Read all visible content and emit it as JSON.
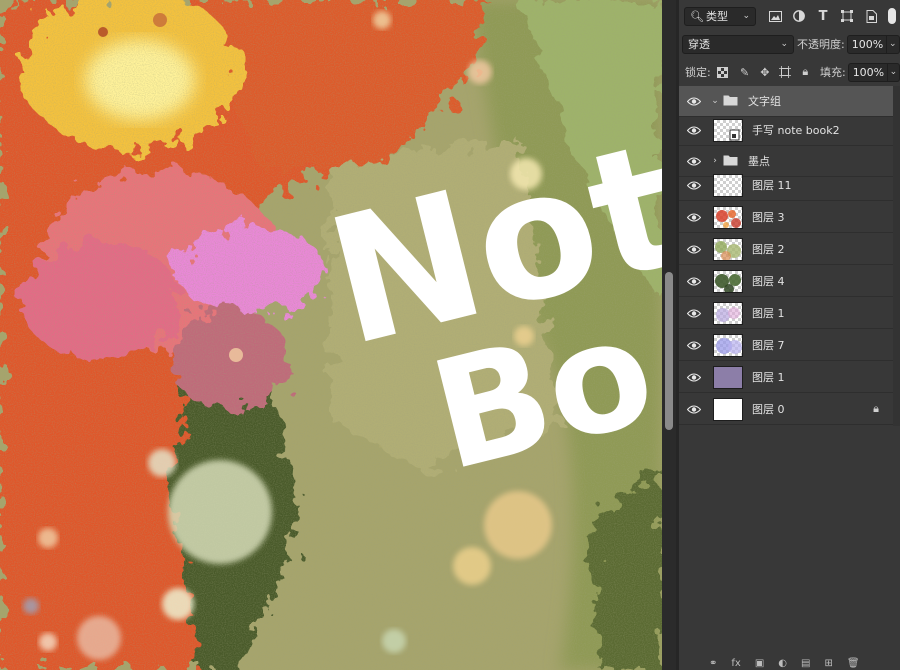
{
  "filter": {
    "kind_label": "类型",
    "search_icon": "search-icon"
  },
  "blend": {
    "mode": "穿透",
    "opacity_label": "不透明度:",
    "opacity_value": "100%"
  },
  "lock": {
    "label": "锁定:",
    "fill_label": "填充:",
    "fill_value": "100%"
  },
  "layers": [
    {
      "name": "文字组",
      "type": "group",
      "expanded": true,
      "selected": true
    },
    {
      "name": "手写 note book2",
      "type": "smart-object"
    },
    {
      "name": "墨点",
      "type": "group",
      "expanded": false
    },
    {
      "name": "图层 11",
      "type": "transparent"
    },
    {
      "name": "图层 3",
      "type": "red-flowers"
    },
    {
      "name": "图层 2",
      "type": "green-mix"
    },
    {
      "name": "图层 4",
      "type": "dark-green"
    },
    {
      "name": "图层 1",
      "type": "purple-light"
    },
    {
      "name": "图层 7",
      "type": "purple-blue"
    },
    {
      "name": "图层 1",
      "type": "solid-purple"
    },
    {
      "name": "图层 0",
      "type": "white",
      "locked": true
    }
  ],
  "canvas_text": {
    "line1": "Not",
    "line2": "Bo"
  },
  "colors": {
    "panel_bg": "#383838",
    "selected_row": "#555555",
    "canvas_green": "#a4a36a",
    "canvas_orange": "#e0562a"
  }
}
